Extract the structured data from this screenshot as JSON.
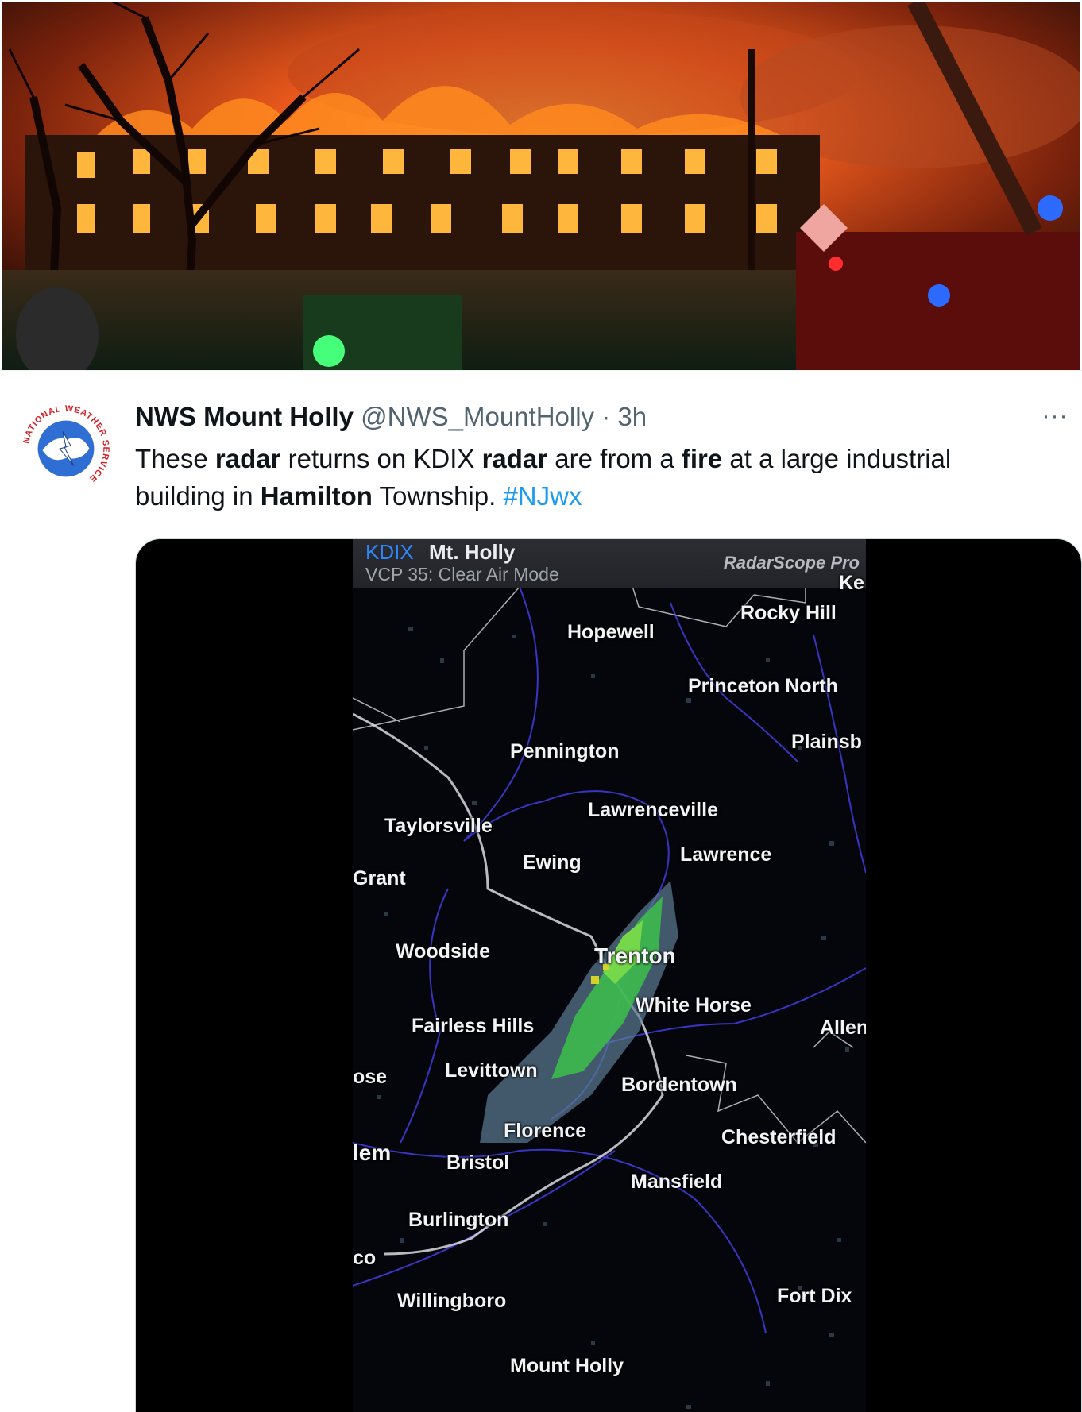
{
  "tweet": {
    "display_name": "NWS Mount Holly",
    "handle": "@NWS_MountHolly",
    "separator": "·",
    "time": "3h",
    "more": "···",
    "text": {
      "p1": "These ",
      "b1": "radar",
      "p2": " returns on KDIX ",
      "b2": "radar",
      "p3": " are from a ",
      "b3": "fire",
      "p4": " at a large industrial building in ",
      "b4": "Hamilton",
      "p5": " Township. ",
      "hashtag": "#NJwx"
    },
    "avatar_ring_text": "NATIONAL WEATHER SERVICE"
  },
  "radar": {
    "station_id": "KDIX",
    "station_name": "Mt. Holly",
    "scan_mode": "VCP 35: Clear Air Mode",
    "app_brand": "RadarScope Pro",
    "places": {
      "ke": "Ke",
      "rocky_hill": "Rocky Hill",
      "hopewell": "Hopewell",
      "princeton_north": "Princeton North",
      "pennington": "Pennington",
      "plainsb": "Plainsb",
      "lawrenceville": "Lawrenceville",
      "taylorsville": "Taylorsville",
      "ewing": "Ewing",
      "lawrence": "Lawrence",
      "grant": "Grant",
      "woodside": "Woodside",
      "trenton": "Trenton",
      "white_horse": "White Horse",
      "fairless_hills": "Fairless Hills",
      "allen": "Allen",
      "ose": "ose",
      "levittown": "Levittown",
      "bordentown": "Bordentown",
      "florence": "Florence",
      "chesterfield": "Chesterfield",
      "lem": "lem",
      "bristol": "Bristol",
      "mansfield": "Mansfield",
      "burlington": "Burlington",
      "co": "co",
      "willingboro": "Willingboro",
      "fort_dix": "Fort Dix",
      "mount_holly": "Mount Holly"
    },
    "colors": {
      "county_lines": "#3d3bd6",
      "state_line": "#d9dbe0",
      "reflectivity_low": "#5f7f96",
      "reflectivity_mid": "#3cbf4a",
      "reflectivity_high": "#d6d22a"
    }
  }
}
